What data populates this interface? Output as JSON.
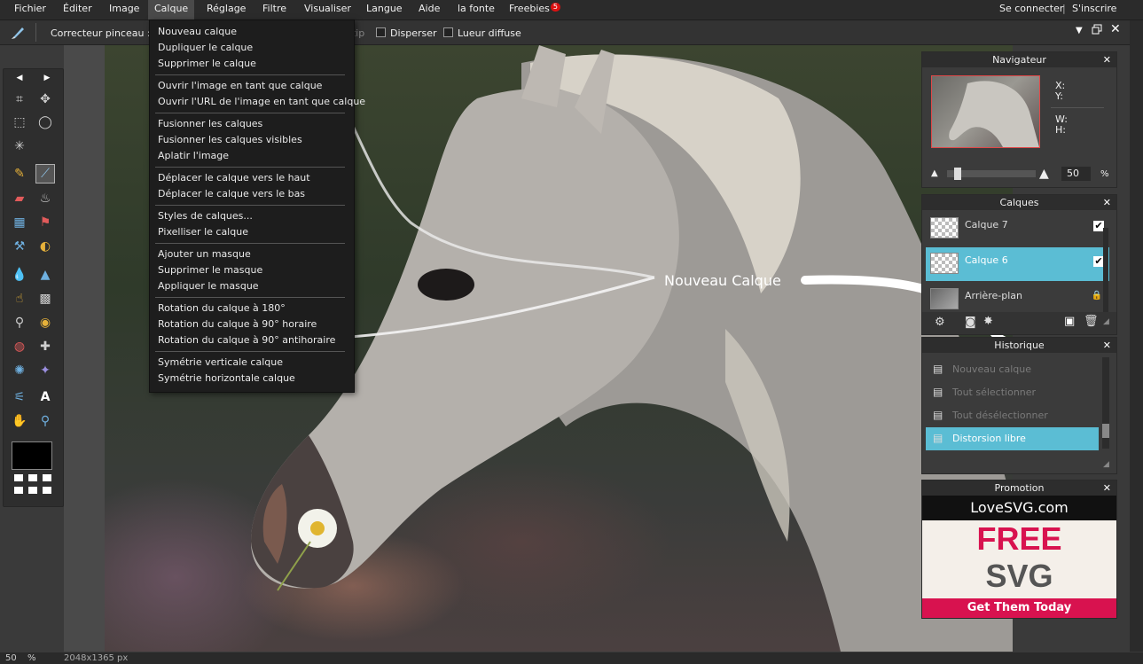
{
  "menubar": {
    "items": [
      "Fichier",
      "Éditer",
      "Image",
      "Calque",
      "Réglage",
      "Filtre",
      "Visualiser",
      "Langue",
      "Aide",
      "la fonte",
      "Freebies"
    ],
    "freebies_badge": "5",
    "login": "Se connecter",
    "separator": "|",
    "signup": "S'inscrire"
  },
  "optionbar": {
    "tool_name": "Correcteur pinceau :",
    "hard_tip": "Hard tip",
    "scatter": "Disperser",
    "glow": "Lueur diffuse"
  },
  "dropdown": {
    "items": [
      "Nouveau calque",
      "Dupliquer le calque",
      "Supprimer le calque",
      "Ouvrir l'image en tant que calque",
      "Ouvrir l'URL de l'image en tant que calque",
      "Fusionner les calques",
      "Fusionner les calques visibles",
      "Aplatir l'image",
      "Déplacer le calque vers le haut",
      "Déplacer le calque vers le bas",
      "Styles de calques...",
      "Pixelliser le calque",
      "Ajouter un masque",
      "Supprimer le masque",
      "Appliquer le masque",
      "Rotation du calque à 180°",
      "Rotation du calque à 90° horaire",
      "Rotation du calque à 90° antihoraire",
      "Symétrie verticale calque",
      "Symétrie horizontale calque"
    ]
  },
  "canvas": {
    "annotation": "Nouveau Calque"
  },
  "navigator": {
    "title": "Navigateur",
    "x_label": "X:",
    "y_label": "Y:",
    "w_label": "W:",
    "h_label": "H:",
    "zoom": "50",
    "zoom_unit": "%",
    "zoom_slider_level": 0.08
  },
  "layers": {
    "title": "Calques",
    "items": [
      {
        "name": "Calque 7",
        "visible": true
      },
      {
        "name": "Calque 6",
        "visible": true
      },
      {
        "name": "Arrière-plan",
        "locked": true
      }
    ]
  },
  "history": {
    "title": "Historique",
    "items": [
      "Nouveau calque",
      "Tout sélectionner",
      "Tout désélectionner",
      "Distorsion libre"
    ]
  },
  "promo": {
    "title": "Promotion",
    "brand": "LoveSVG.com",
    "line1": "FREE",
    "line2": "SVG",
    "cta": "Get Them Today"
  },
  "status": {
    "zoom": "50",
    "unit": "%",
    "size": "2048x1365 px"
  },
  "colors": {
    "accent": "#5bbdd4",
    "promo_pink": "#d8124f",
    "badge": "#d11111"
  }
}
